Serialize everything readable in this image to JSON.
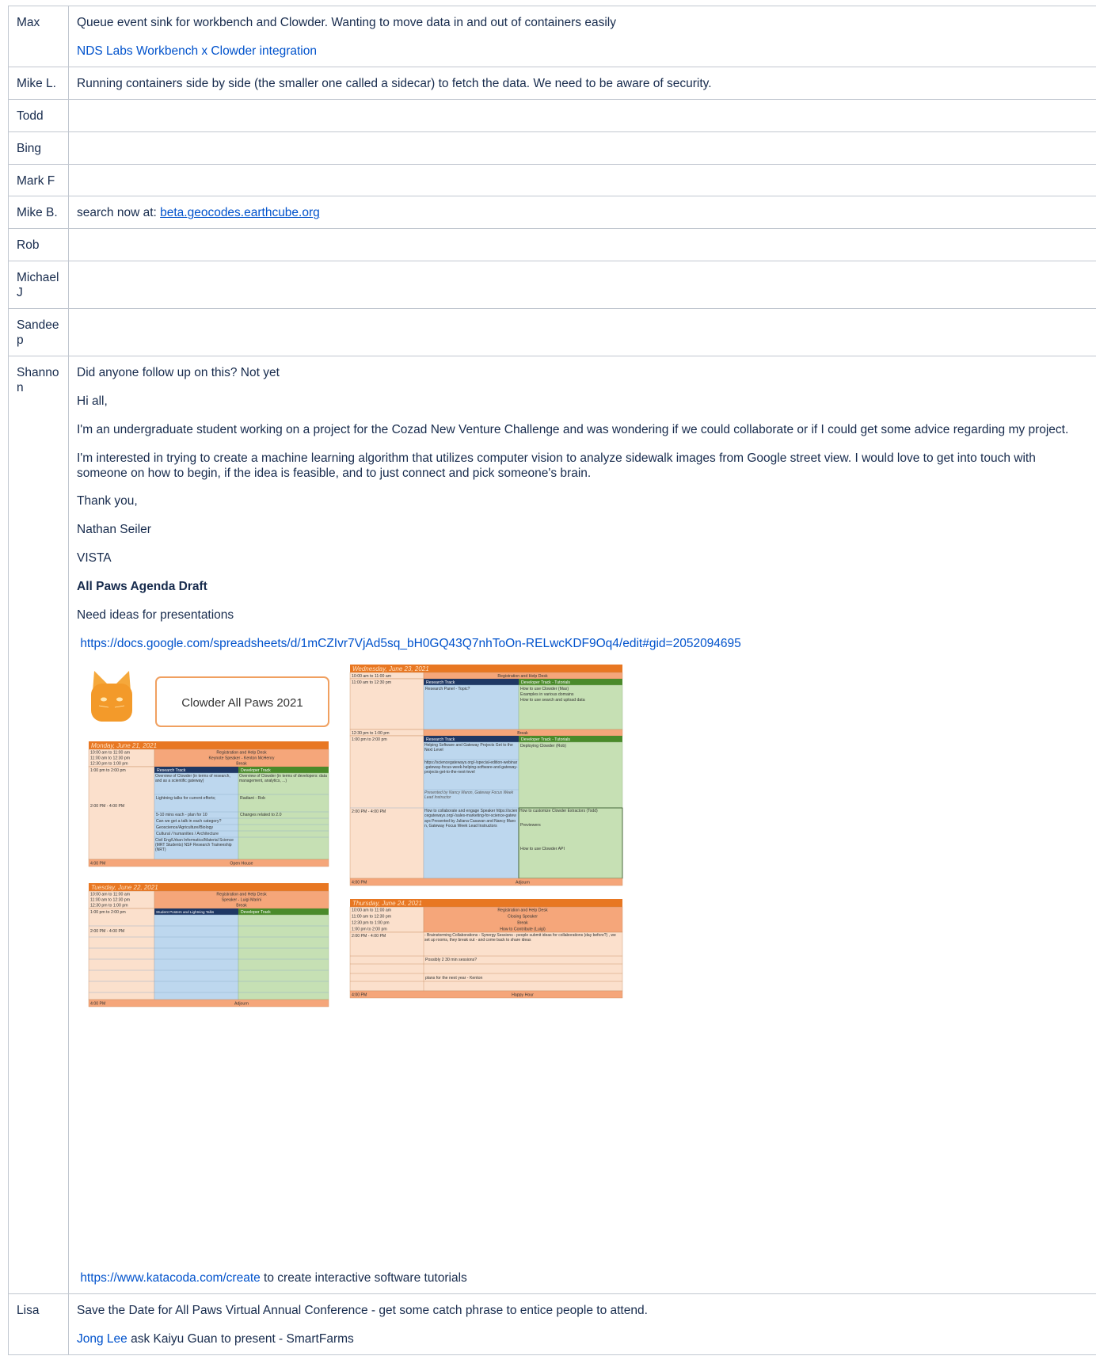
{
  "rows": {
    "max": {
      "name": "Max",
      "text": "Queue event sink for workbench and Clowder. Wanting to move data in and out of containers easily",
      "link": "NDS Labs Workbench x Clowder integration"
    },
    "mike_l": {
      "name": "Mike L.",
      "text": "Running containers side by side (the smaller one called a sidecar) to fetch the data.  We need to be aware of security."
    },
    "todd": {
      "name": "Todd"
    },
    "bing": {
      "name": "Bing"
    },
    "mark_f": {
      "name": "Mark F"
    },
    "mike_b": {
      "name": "Mike B.",
      "text": "search now at: ",
      "link": "beta.geocodes.earthcube.org"
    },
    "rob": {
      "name": "Rob"
    },
    "michael_j": {
      "name": "Michael J"
    },
    "sandeep": {
      "name": "Sandeep"
    },
    "shannon": {
      "name": "Shannon",
      "p1": "Did anyone follow up on this? Not yet",
      "p2": "Hi all,",
      "p3": "I'm an undergraduate student working on a project for the Cozad New Venture Challenge and was wondering if we could collaborate or if I could get some advice regarding my project.",
      "p4": "I'm interested in trying to create a machine learning algorithm that utilizes computer vision to analyze sidewalk images from Google street view. I would love to get into touch with someone on how to begin, if the idea is feasible, and to just connect and pick someone's brain.",
      "p5": "Thank you,",
      "p6": "Nathan Seiler",
      "p7": "VISTA",
      "p8": "All Paws Agenda Draft",
      "p9": "Need ideas for presentations",
      "sheet_link": "https://docs.google.com/spreadsheets/d/1mCZIvr7VjAd5sq_bH0GQ43Q7nhToOn-RELwcKDF9Oq4/edit#gid=2052094695",
      "katacoda_link": "https://www.katacoda.com/create",
      "katacoda_text": " to create interactive software tutorials"
    },
    "lisa": {
      "name": "Lisa",
      "p1": "Save the Date for All Paws Virtual Annual Conference - get some catch phrase to entice people to attend.",
      "link": "Jong Lee",
      "p2": " ask Kaiyu Guan to present - SmartFarms"
    }
  },
  "agenda": {
    "banner": "Clowder All Paws 2021",
    "monday": {
      "day": "Monday, June 21, 2021",
      "rows": [
        [
          "10:00 am to 11:00 am",
          "Registration and Help Desk"
        ],
        [
          "11:00 am to 12:30 pm",
          "Keynote Speaker - Kenton McHenry"
        ],
        [
          "12:30 pm to 1:00 pm",
          "Break"
        ]
      ],
      "t4": "1:00 pm to 2:00 pm",
      "research": "Research Track",
      "developer": "Developer Track",
      "r1": "Overview of Clowder (in terms of research, and as a scientific gateway)",
      "d1": "Overview of Clowder (in terms of developers: data management, analytics, ...)",
      "r2": "Lightning talks for current efforts;",
      "d2": "Radiant - Rob",
      "t5": "2:00 PM - 4:00 PM",
      "r3": "5-10 mins each - plan for 10",
      "d3": "Changes related to 2.0",
      "r4": "Can we get a talk in each category?",
      "r5": "Geoscience/Agriculture/Biology",
      "r6": "Cultural / humanities / Architecture",
      "r7": "Civil Eng/Urban Informatics/Material Science (MRT Students) NSF Research Traineeship (NRT)",
      "t6": "4:00 PM",
      "end": "Open House"
    },
    "tuesday": {
      "day": "Tuesday, June 22, 2021",
      "rows": [
        [
          "10:00 am to 11:00 am",
          "Registration and Help Desk"
        ],
        [
          "11:00 am to 12:30 pm",
          "Speaker - Luigi Marini"
        ],
        [
          "12:30 pm to 1:00 pm",
          "Break"
        ]
      ],
      "t4": "1:00 pm to 2:00 pm",
      "research": "Student Posters and Lightning Talks",
      "developer": "Developer Track",
      "t5": "2:00 PM - 4:00 PM",
      "t6": "4:00 PM",
      "end": "Adjourn"
    },
    "wednesday": {
      "day": "Wednesday, June 23, 2021",
      "t1": "10:00 am to 11:00 am",
      "c1": "Registration and Help Desk",
      "t2": "11:00 am to 12:30 pm",
      "research": "Research Track",
      "developer": "Developer Track - Tutorials",
      "r1": "Research Panel - Topic?",
      "d1": "How to use Clowder (Max)",
      "d1b": "Examples in various domains",
      "d1c": "How to use search and upload data",
      "t3": "12:30 pm to 1:00 pm",
      "c3": "Break",
      "t4": "1:00 pm to 2:00 pm",
      "r2": "Helping Software and Gateway Projects Get to the Next Level",
      "d2": "Deploying Clowder (Rob)",
      "r3": "https://sciencegateways.org/-/special-edition-webinar-gateway-focus-week-helping-software-and-gateway-projects-get-to-the-next-level",
      "r4": "Presented by Nancy Maron, Gateway Focus Week Lead Instructor",
      "t5": "2:00 PM - 4:00 PM",
      "r5": "How to collaborate and engage Speaker https://sciencegateways.org/-/sales-marketing-for-science-gateways Presented by Juliana Casavan and Nancy Maron, Gateway Focus Week Lead Instructors",
      "d5": "How to customize Clowder Extractors (Todd)",
      "d5b": "Previewers",
      "d5c": "How to use Clowder API",
      "t6": "4:00 PM",
      "end": "Adjourn"
    },
    "thursday": {
      "day": "Thursday, June 24, 2021",
      "rows": [
        [
          "10:00 am to 11:00 am",
          "Registration and Help Desk"
        ],
        [
          "11:00 am to 12:30 pm",
          "Closing Speaker"
        ],
        [
          "12:30 pm to 1:00 pm",
          "Break"
        ],
        [
          "1:00 pm to 2:00 pm",
          "How to Contribute (Luigi)"
        ]
      ],
      "t5": "2:00 PM - 4:00 PM",
      "n1": "- Brainstorming Collaborations - Synergy Sessions - people submit ideas for collaborations (day before?) , we set up rooms, they break out - and come back to share ideas",
      "n2": "Possibly 2 30 min sessions?",
      "n3": "plans for the next year - Kenton",
      "t6": "4:00 PM",
      "end": "Happy Hour"
    }
  }
}
